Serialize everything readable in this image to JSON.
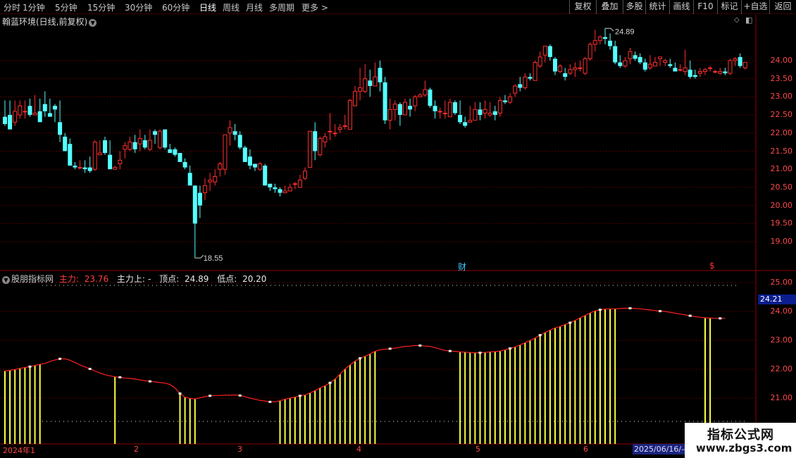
{
  "toolbar": {
    "periods": [
      "分时",
      "1分钟",
      "5分钟",
      "15分钟",
      "30分钟",
      "60分钟",
      "日线",
      "周线",
      "月线",
      "多周期",
      "更多"
    ],
    "active_period": "日线",
    "more_arrow": ">",
    "buttons": [
      "复权",
      "叠加",
      "多股",
      "统计",
      "画线",
      "F10",
      "标记",
      "+自选",
      "返回"
    ]
  },
  "main_chart": {
    "title": "翰蓝环境(日线,前复权)",
    "high_label": "24.89",
    "low_label": "18.55",
    "finance_mark": "财",
    "s_mark": "$",
    "y_ticks": [
      "24.00",
      "23.50",
      "23.00",
      "22.50",
      "22.00",
      "21.50",
      "21.00",
      "20.50",
      "20.00",
      "19.50",
      "19.00"
    ],
    "candles": [
      [
        22.45,
        22.65,
        22.25,
        22.2,
        22.9
      ],
      [
        22.5,
        22.3,
        22.1,
        22.3,
        22.9
      ],
      [
        22.3,
        22.65,
        22.6,
        22.2,
        22.9
      ],
      [
        22.5,
        22.6,
        22.75,
        22.4,
        22.9
      ],
      [
        22.6,
        22.6,
        22.6,
        22.4,
        22.9
      ],
      [
        22.75,
        22.7,
        22.5,
        22.45,
        22.95
      ],
      [
        22.5,
        22.75,
        22.55,
        22.5,
        23.05
      ],
      [
        22.6,
        22.7,
        22.3,
        22.4,
        22.95
      ],
      [
        22.8,
        22.4,
        22.6,
        22.45,
        23.15
      ],
      [
        22.55,
        22.85,
        22.45,
        22.45,
        22.95
      ],
      [
        22.75,
        22.5,
        22.65,
        22.3,
        22.8
      ],
      [
        22.3,
        22.5,
        21.95,
        21.75,
        22.9
      ],
      [
        21.9,
        21.7,
        21.5,
        21.6,
        22.0
      ],
      [
        21.7,
        21.8,
        21.1,
        21.1,
        21.85
      ],
      [
        21.1,
        21.4,
        21.05,
        21.0,
        21.2
      ],
      [
        21.05,
        21.1,
        21.05,
        21.0,
        21.25
      ],
      [
        21.05,
        21.1,
        21.0,
        20.9,
        21.25
      ],
      [
        21.05,
        21.0,
        20.95,
        20.9,
        21.35
      ],
      [
        21.0,
        21.25,
        21.75,
        20.95,
        21.8
      ],
      [
        21.4,
        21.75,
        21.45,
        21.4,
        21.8
      ],
      [
        21.8,
        21.8,
        21.45,
        21.4,
        21.9
      ],
      [
        21.4,
        21.45,
        21.0,
        21.0,
        21.8
      ],
      [
        21.0,
        21.0,
        21.05,
        21.0,
        21.1
      ],
      [
        21.15,
        21.05,
        21.25,
        21.0,
        21.5
      ],
      [
        21.55,
        21.65,
        21.65,
        21.3,
        21.75
      ],
      [
        21.55,
        21.55,
        21.75,
        21.5,
        21.9
      ],
      [
        21.75,
        21.8,
        21.55,
        21.45,
        21.95
      ],
      [
        21.7,
        21.55,
        21.85,
        21.5,
        22.1
      ],
      [
        21.8,
        21.75,
        21.6,
        21.55,
        21.95
      ],
      [
        21.55,
        21.7,
        21.8,
        21.5,
        22.1
      ],
      [
        22.05,
        21.8,
        21.95,
        21.7,
        22.1
      ],
      [
        21.6,
        21.85,
        22.05,
        21.55,
        22.1
      ],
      [
        22.1,
        21.85,
        21.6,
        21.55,
        22.1
      ],
      [
        21.55,
        21.6,
        21.45,
        21.5,
        21.7
      ],
      [
        21.55,
        21.4,
        21.4,
        21.35,
        21.6
      ],
      [
        21.45,
        21.3,
        21.2,
        21.2,
        21.45
      ],
      [
        21.2,
        21.0,
        21.05,
        21.0,
        21.3
      ],
      [
        20.9,
        20.9,
        20.55,
        20.8,
        21.1
      ],
      [
        20.55,
        20.5,
        19.5,
        18.55,
        20.55
      ],
      [
        20.35,
        19.7,
        20.0,
        19.65,
        20.55
      ],
      [
        20.35,
        20.3,
        20.55,
        20.15,
        20.75
      ],
      [
        20.65,
        20.55,
        20.7,
        20.4,
        20.9
      ],
      [
        20.65,
        20.75,
        20.8,
        20.55,
        21.0
      ],
      [
        21.0,
        20.85,
        21.15,
        20.8,
        21.2
      ],
      [
        21.0,
        21.0,
        21.95,
        20.85,
        21.95
      ],
      [
        22.0,
        21.65,
        22.15,
        21.65,
        22.35
      ],
      [
        22.05,
        21.9,
        21.95,
        21.8,
        22.25
      ],
      [
        21.95,
        21.95,
        21.6,
        21.55,
        22.05
      ],
      [
        21.6,
        21.4,
        21.2,
        21.25,
        21.65
      ],
      [
        21.35,
        21.3,
        21.1,
        21.0,
        21.55
      ],
      [
        21.15,
        21.0,
        21.05,
        20.95,
        21.1
      ],
      [
        21.0,
        21.0,
        21.15,
        20.95,
        21.2
      ],
      [
        21.1,
        21.05,
        20.55,
        20.6,
        21.15
      ],
      [
        20.6,
        20.5,
        20.5,
        20.4,
        20.6
      ],
      [
        20.5,
        20.5,
        20.45,
        20.35,
        20.6
      ],
      [
        20.45,
        20.45,
        20.35,
        20.25,
        20.5
      ],
      [
        20.35,
        20.45,
        20.4,
        20.35,
        20.55
      ],
      [
        20.4,
        20.45,
        20.5,
        20.4,
        20.6
      ],
      [
        20.6,
        20.5,
        20.6,
        20.45,
        20.65
      ],
      [
        20.5,
        20.6,
        20.7,
        20.5,
        20.85
      ],
      [
        20.75,
        20.7,
        20.95,
        20.7,
        21.05
      ],
      [
        21.05,
        21.45,
        22.05,
        21.4,
        22.05
      ],
      [
        22.05,
        21.35,
        21.5,
        21.25,
        22.3
      ],
      [
        21.4,
        21.5,
        21.85,
        21.35,
        21.9
      ],
      [
        21.75,
        21.75,
        21.9,
        21.6,
        22.0
      ],
      [
        22.05,
        21.95,
        22.05,
        21.8,
        22.55
      ],
      [
        22.0,
        22.05,
        22.0,
        21.9,
        22.25
      ],
      [
        22.1,
        22.05,
        22.15,
        22.0,
        22.25
      ],
      [
        22.2,
        22.1,
        22.2,
        22.1,
        22.5
      ],
      [
        22.1,
        22.3,
        22.9,
        22.1,
        22.95
      ],
      [
        22.75,
        23.2,
        23.15,
        22.95,
        23.3
      ],
      [
        23.15,
        23.05,
        23.25,
        22.9,
        23.8
      ],
      [
        23.15,
        23.35,
        23.5,
        23.1,
        23.9
      ],
      [
        23.45,
        23.25,
        23.3,
        23.0,
        23.75
      ],
      [
        23.3,
        23.6,
        23.55,
        23.3,
        23.95
      ],
      [
        23.8,
        23.4,
        23.4,
        23.15,
        24.0
      ],
      [
        23.4,
        22.9,
        22.35,
        22.25,
        23.55
      ],
      [
        22.35,
        22.1,
        22.65,
        22.1,
        22.95
      ],
      [
        22.65,
        22.65,
        22.8,
        22.35,
        22.9
      ],
      [
        22.8,
        22.75,
        22.5,
        22.2,
        22.85
      ],
      [
        22.5,
        22.5,
        22.85,
        22.5,
        22.95
      ],
      [
        22.75,
        22.7,
        22.65,
        22.45,
        22.95
      ],
      [
        22.75,
        22.75,
        23.0,
        22.6,
        23.05
      ],
      [
        23.0,
        23.0,
        23.05,
        23.0,
        23.1
      ],
      [
        23.05,
        23.2,
        23.2,
        23.0,
        23.45
      ],
      [
        23.2,
        22.9,
        22.75,
        22.7,
        23.25
      ],
      [
        22.75,
        22.8,
        22.6,
        22.4,
        22.9
      ],
      [
        22.6,
        22.6,
        22.6,
        22.4,
        22.7
      ],
      [
        22.55,
        22.55,
        22.55,
        22.4,
        22.9
      ],
      [
        22.45,
        22.7,
        22.85,
        22.45,
        22.95
      ],
      [
        22.85,
        22.5,
        22.55,
        22.5,
        22.9
      ],
      [
        22.5,
        22.45,
        22.3,
        22.25,
        22.9
      ],
      [
        22.3,
        22.3,
        22.2,
        22.15,
        22.45
      ],
      [
        22.3,
        22.3,
        22.35,
        22.3,
        22.75
      ],
      [
        22.35,
        22.5,
        22.65,
        22.35,
        22.85
      ],
      [
        22.65,
        22.5,
        22.5,
        22.35,
        22.85
      ],
      [
        22.55,
        22.6,
        22.65,
        22.4,
        22.9
      ],
      [
        22.5,
        22.5,
        22.55,
        22.45,
        22.85
      ],
      [
        22.6,
        22.55,
        22.5,
        22.35,
        22.75
      ],
      [
        22.55,
        22.5,
        22.9,
        22.45,
        23.0
      ],
      [
        22.9,
        22.85,
        22.85,
        22.8,
        23.05
      ],
      [
        22.85,
        23.0,
        23.0,
        22.8,
        23.1
      ],
      [
        23.1,
        23.1,
        23.3,
        23.0,
        23.35
      ],
      [
        23.35,
        23.3,
        23.25,
        23.15,
        23.55
      ],
      [
        23.25,
        23.3,
        23.55,
        23.2,
        23.65
      ],
      [
        23.55,
        23.6,
        23.5,
        23.45,
        23.65
      ],
      [
        23.45,
        24.0,
        23.95,
        23.6,
        24.0
      ],
      [
        23.85,
        24.05,
        24.1,
        23.8,
        24.25
      ],
      [
        24.15,
        24.15,
        24.4,
        23.95,
        24.35
      ],
      [
        24.4,
        24.05,
        24.1,
        24.0,
        24.45
      ],
      [
        24.05,
        23.75,
        23.7,
        23.6,
        24.1
      ],
      [
        23.7,
        23.7,
        23.85,
        23.65,
        23.9
      ],
      [
        23.65,
        23.65,
        23.55,
        23.45,
        23.8
      ],
      [
        23.65,
        23.75,
        23.75,
        23.6,
        23.9
      ],
      [
        23.75,
        23.65,
        23.8,
        23.55,
        23.95
      ],
      [
        23.8,
        23.9,
        23.8,
        23.7,
        24.0
      ],
      [
        23.65,
        23.95,
        24.05,
        23.6,
        24.1
      ],
      [
        24.05,
        24.15,
        24.45,
        24.0,
        24.5
      ],
      [
        24.45,
        24.6,
        24.55,
        24.25,
        24.85
      ],
      [
        24.55,
        24.55,
        24.65,
        24.45,
        24.7
      ],
      [
        24.65,
        24.6,
        24.6,
        24.45,
        24.89
      ],
      [
        24.55,
        24.5,
        24.4,
        24.3,
        24.75
      ],
      [
        24.4,
        24.25,
        23.95,
        23.9,
        24.55
      ],
      [
        23.95,
        24.05,
        23.85,
        23.8,
        24.15
      ],
      [
        23.85,
        23.95,
        24.0,
        23.8,
        24.1
      ],
      [
        24.05,
        24.2,
        24.25,
        23.9,
        24.35
      ],
      [
        24.15,
        24.1,
        24.05,
        24.0,
        24.25
      ],
      [
        24.1,
        23.95,
        23.95,
        23.9,
        24.2
      ],
      [
        23.95,
        23.85,
        23.75,
        23.7,
        24.05
      ],
      [
        23.8,
        23.9,
        23.9,
        23.75,
        24.15
      ],
      [
        23.85,
        23.95,
        23.95,
        23.85,
        24.1
      ],
      [
        24.05,
        23.95,
        24.1,
        23.85,
        24.1
      ],
      [
        23.95,
        23.95,
        24.0,
        23.85,
        24.05
      ],
      [
        23.9,
        23.85,
        23.85,
        23.8,
        24.05
      ],
      [
        23.8,
        23.75,
        23.7,
        23.7,
        23.95
      ],
      [
        23.75,
        23.7,
        23.75,
        23.7,
        23.9
      ],
      [
        23.7,
        23.75,
        23.8,
        23.6,
        24.3
      ],
      [
        23.75,
        23.85,
        23.55,
        23.5,
        24.0
      ],
      [
        23.6,
        23.65,
        23.55,
        23.5,
        23.75
      ],
      [
        23.65,
        23.6,
        23.7,
        23.55,
        23.8
      ],
      [
        23.7,
        23.75,
        23.75,
        23.6,
        23.8
      ],
      [
        23.8,
        23.8,
        23.8,
        23.7,
        23.85
      ],
      [
        23.7,
        23.7,
        23.7,
        23.65,
        23.75
      ],
      [
        23.65,
        23.7,
        23.7,
        23.6,
        23.8
      ],
      [
        23.7,
        23.6,
        23.65,
        23.6,
        23.8
      ],
      [
        23.65,
        23.65,
        24.0,
        23.6,
        24.05
      ],
      [
        24.0,
        24.05,
        24.05,
        23.85,
        24.1
      ],
      [
        24.1,
        24.0,
        23.85,
        23.8,
        24.2
      ],
      [
        23.8,
        23.8,
        23.95,
        23.75,
        23.9
      ]
    ]
  },
  "indicator": {
    "name": "股朋指标网",
    "main_label": "主力:",
    "main_value": "23.76",
    "main_up_label": "主力上:",
    "main_up_value": "-",
    "top_label": "顶点:",
    "top_value": "24.89",
    "low_label": "低点:",
    "low_value": "20.20",
    "y_ticks": [
      "25.00",
      "24.00",
      "23.00",
      "22.00",
      "21.00"
    ],
    "current_price_tag": "24.21",
    "series": [
      {
        "name": "主力",
        "values": [
          21.94,
          21.96,
          21.99,
          22.03,
          22.06,
          22.09,
          22.13,
          22.17,
          22.2,
          22.27,
          22.32,
          22.36,
          22.36,
          22.31,
          22.23,
          22.15,
          22.08,
          22.01,
          21.94,
          21.87,
          21.81,
          21.77,
          21.74,
          21.72,
          21.69,
          21.68,
          21.66,
          21.63,
          21.6,
          21.58,
          21.56,
          21.54,
          21.52,
          21.47,
          21.35,
          21.16,
          21.03,
          20.99,
          20.97,
          21.01,
          21.05,
          21.08,
          21.09,
          21.09,
          21.1,
          21.1,
          21.11,
          21.09,
          21.05,
          21.0,
          20.96,
          20.92,
          20.9,
          20.87,
          20.87,
          20.91,
          20.96,
          21.0,
          21.04,
          21.08,
          21.11,
          21.18,
          21.26,
          21.35,
          21.43,
          21.53,
          21.66,
          21.83,
          22.01,
          22.15,
          22.28,
          22.38,
          22.45,
          22.53,
          22.62,
          22.67,
          22.69,
          22.71,
          22.73,
          22.76,
          22.79,
          22.8,
          22.82,
          22.82,
          22.8,
          22.79,
          22.75,
          22.7,
          22.65,
          22.63,
          22.62,
          22.6,
          22.59,
          22.58,
          22.57,
          22.57,
          22.58,
          22.6,
          22.61,
          22.63,
          22.67,
          22.72,
          22.77,
          22.84,
          22.92,
          23.0,
          23.08,
          23.18,
          23.27,
          23.35,
          23.43,
          23.48,
          23.55,
          23.61,
          23.69,
          23.78,
          23.86,
          23.95,
          24.02,
          24.06,
          24.08,
          24.09,
          24.09,
          24.1,
          24.11,
          24.11,
          24.1,
          24.09,
          24.07,
          24.05,
          24.03,
          24.01,
          24.0,
          23.97,
          23.94,
          23.91,
          23.88,
          23.85,
          23.82,
          23.8,
          23.78,
          23.77,
          23.76,
          23.76,
          23.76
        ]
      },
      {
        "name": "主力上",
        "values": [
          21.94,
          21.96,
          21.99,
          22.03,
          22.06,
          22.09,
          22.13,
          22.17,
          null,
          null,
          null,
          null,
          null,
          null,
          null,
          null,
          null,
          null,
          null,
          null,
          null,
          null,
          21.74,
          null,
          null,
          null,
          null,
          null,
          null,
          null,
          null,
          null,
          null,
          null,
          null,
          21.16,
          21.03,
          20.99,
          20.97,
          null,
          null,
          null,
          null,
          null,
          null,
          null,
          null,
          null,
          null,
          null,
          null,
          null,
          null,
          null,
          null,
          20.91,
          20.96,
          21.0,
          21.04,
          21.08,
          21.11,
          21.18,
          21.26,
          21.35,
          21.43,
          21.53,
          21.66,
          21.83,
          22.01,
          22.15,
          22.28,
          22.38,
          22.45,
          22.53,
          22.62,
          null,
          null,
          null,
          null,
          null,
          null,
          null,
          null,
          null,
          null,
          null,
          null,
          null,
          null,
          null,
          null,
          22.6,
          22.59,
          22.58,
          22.57,
          22.57,
          22.58,
          22.6,
          22.61,
          22.63,
          22.67,
          22.72,
          22.77,
          22.84,
          22.92,
          23.0,
          23.08,
          23.18,
          23.27,
          23.35,
          23.43,
          23.48,
          23.55,
          23.61,
          23.69,
          23.78,
          23.86,
          23.95,
          24.02,
          24.06,
          24.08,
          24.09,
          24.09,
          null,
          null,
          null,
          null,
          null,
          null,
          null,
          null,
          null,
          null,
          null,
          null,
          null,
          null,
          null,
          null,
          null,
          23.77,
          23.76,
          null,
          null
        ]
      }
    ]
  },
  "dates": {
    "labels": [
      "2024年1",
      "2",
      "3",
      "4",
      "5",
      "6"
    ],
    "current": "2025/06/16/—"
  },
  "watermark": {
    "line1": "指标公式网",
    "line2": "www.zbgs3.com"
  },
  "colors": {
    "up": "#ff3030",
    "down": "#54ffff",
    "axis": "#ff4848",
    "grid": "#8b0000",
    "bar": "#ffff40",
    "line": "#ff2020"
  }
}
